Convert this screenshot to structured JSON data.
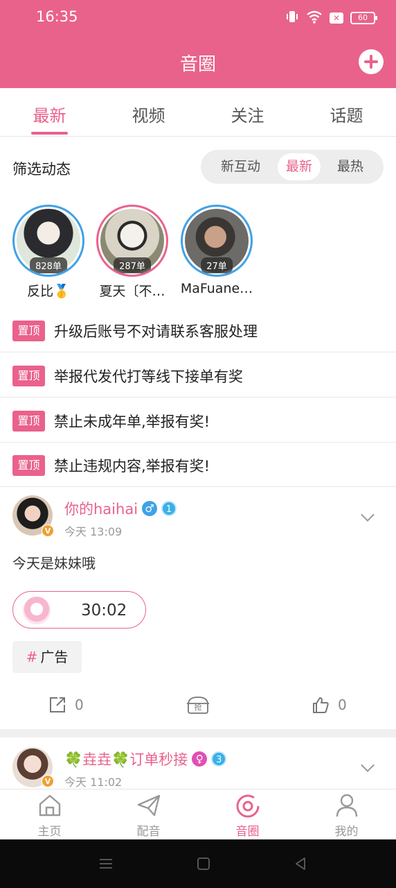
{
  "status_bar": {
    "time": "16:35",
    "battery": "60"
  },
  "header": {
    "title": "音圈"
  },
  "tabs": [
    {
      "label": "最新",
      "active": true
    },
    {
      "label": "视频",
      "active": false
    },
    {
      "label": "关注",
      "active": false
    },
    {
      "label": "话题",
      "active": false
    }
  ],
  "filter": {
    "label": "筛选动态",
    "options": [
      {
        "label": "新互动",
        "active": false
      },
      {
        "label": "最新",
        "active": true
      },
      {
        "label": "最热",
        "active": false
      }
    ]
  },
  "featured_users": [
    {
      "name": "反比🥇",
      "orders": "828单"
    },
    {
      "name": "夏天〔不…",
      "orders": "287单"
    },
    {
      "name": "MaFuane…",
      "orders": "27单"
    }
  ],
  "pinned_badge": "置顶",
  "pinned": [
    "升级后账号不对请联系客服处理",
    "举报代发代打等线下接单有奖",
    "禁止未成年单,举报有奖!",
    "禁止违规内容,举报有奖!"
  ],
  "posts": [
    {
      "author": "你的haihai",
      "gender_symbol": "♂",
      "level": "1",
      "v_badge": "V",
      "time": "今天 13:09",
      "text": "今天是妹妹哦",
      "audio_duration": "30:02",
      "tag_hash": "#",
      "tag": "广告",
      "share_count": "0",
      "grab_label": "抢",
      "like_count": "0"
    },
    {
      "author": "🍀垚垚🍀订单秒接",
      "gender_symbol": "♀",
      "level": "3",
      "v_badge": "V",
      "time": "今天 11:02"
    }
  ],
  "bottom_nav": [
    {
      "label": "主页",
      "active": false
    },
    {
      "label": "配音",
      "active": false
    },
    {
      "label": "音圈",
      "active": true
    },
    {
      "label": "我的",
      "active": false
    }
  ],
  "colors": {
    "accent": "#e9628c",
    "level_badge": "#3ab0e8",
    "male": "#3fa2e6",
    "female": "#e24fb4"
  }
}
